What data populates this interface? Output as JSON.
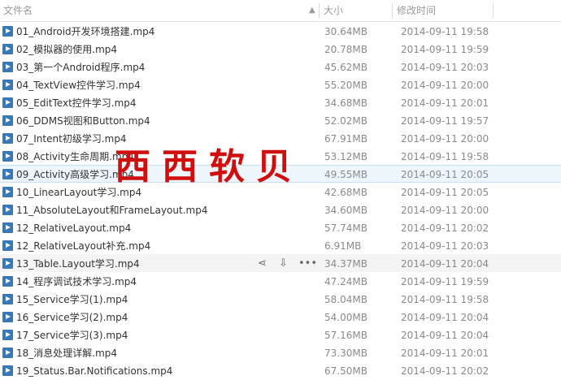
{
  "header": {
    "name_label": "文件名",
    "size_label": "大小",
    "date_label": "修改时间",
    "sort_icon": "caret-up-icon"
  },
  "files": [
    {
      "name": "01_Android开发环境搭建.mp4",
      "size": "30.64MB",
      "date": "2014-09-11 19:58"
    },
    {
      "name": "02_模拟器的使用.mp4",
      "size": "20.78MB",
      "date": "2014-09-11 19:59"
    },
    {
      "name": "03_第一个Android程序.mp4",
      "size": "45.62MB",
      "date": "2014-09-11 20:03"
    },
    {
      "name": "04_TextView控件学习.mp4",
      "size": "55.20MB",
      "date": "2014-09-11 20:00"
    },
    {
      "name": "05_EditText控件学习.mp4",
      "size": "34.68MB",
      "date": "2014-09-11 20:01"
    },
    {
      "name": "06_DDMS视图和Button.mp4",
      "size": "52.02MB",
      "date": "2014-09-11 19:57"
    },
    {
      "name": "07_Intent初级学习.mp4",
      "size": "67.91MB",
      "date": "2014-09-11 20:00"
    },
    {
      "name": "08_Activity生命周期.mp4",
      "size": "53.12MB",
      "date": "2014-09-11 19:58"
    },
    {
      "name": "09_Activity高级学习.mp4",
      "size": "49.55MB",
      "date": "2014-09-11 20:05"
    },
    {
      "name": "10_LinearLayout学习.mp4",
      "size": "42.68MB",
      "date": "2014-09-11 20:05"
    },
    {
      "name": "11_AbsoluteLayout和FrameLayout.mp4",
      "size": "34.60MB",
      "date": "2014-09-11 20:00"
    },
    {
      "name": "12_RelativeLayout.mp4",
      "size": "57.74MB",
      "date": "2014-09-11 20:02"
    },
    {
      "name": "12_RelativeLayout补充.mp4",
      "size": "6.91MB",
      "date": "2014-09-11 20:03"
    },
    {
      "name": "13_Table.Layout学习.mp4",
      "size": "34.37MB",
      "date": "2014-09-11 20:04"
    },
    {
      "name": "14_程序调试技术学习.mp4",
      "size": "47.24MB",
      "date": "2014-09-11 19:59"
    },
    {
      "name": "15_Service学习(1).mp4",
      "size": "58.04MB",
      "date": "2014-09-11 19:58"
    },
    {
      "name": "16_Service学习(2).mp4",
      "size": "54.00MB",
      "date": "2014-09-11 20:04"
    },
    {
      "name": "17_Service学习(3).mp4",
      "size": "57.16MB",
      "date": "2014-09-11 20:04"
    },
    {
      "name": "18_消息处理详解.mp4",
      "size": "73.30MB",
      "date": "2014-09-11 20:01"
    },
    {
      "name": "19_Status.Bar.Notifications.mp4",
      "size": "67.50MB",
      "date": "2014-09-11 20:02"
    }
  ],
  "selected_index": 8,
  "hover_index": 13,
  "hover_actions": [
    {
      "icon": "share-icon"
    },
    {
      "icon": "download-icon"
    },
    {
      "icon": "more-icon"
    }
  ],
  "watermark": "西西软贝",
  "colors": {
    "file_icon": "#3a79b8",
    "selected_row": "#eef6fd",
    "watermark": "#d10e0e"
  }
}
